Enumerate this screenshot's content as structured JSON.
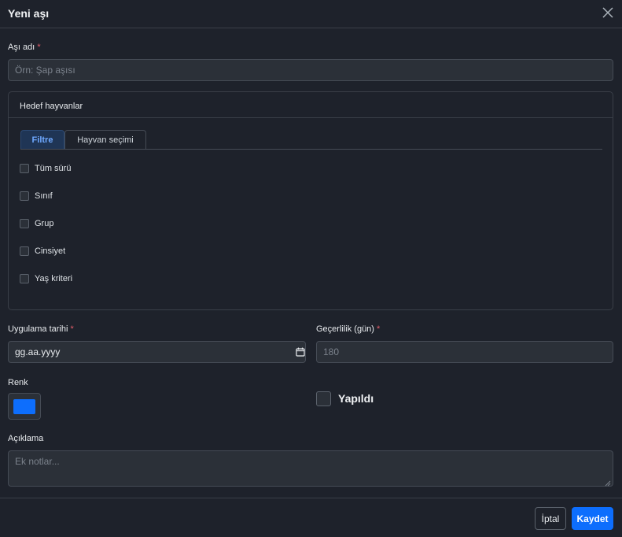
{
  "modal": {
    "title": "Yeni aşı",
    "close_icon": "close-icon"
  },
  "vaccine_name": {
    "label": "Aşı adı",
    "required": "*",
    "value": "",
    "placeholder": "Örn: Şap aşısı"
  },
  "target_animals": {
    "title": "Hedef hayvanlar",
    "tabs": [
      {
        "label": "Filtre",
        "active": true
      },
      {
        "label": "Hayvan seçimi",
        "active": false
      }
    ],
    "filters": [
      {
        "label": "Tüm sürü",
        "checked": false
      },
      {
        "label": "Sınıf",
        "checked": false
      },
      {
        "label": "Grup",
        "checked": false
      },
      {
        "label": "Cinsiyet",
        "checked": false
      },
      {
        "label": "Yaş kriteri",
        "checked": false
      }
    ]
  },
  "application_date": {
    "label": "Uygulama tarihi",
    "required": "*",
    "value": "gg.aa.yyyy",
    "icon": "calendar-icon"
  },
  "validity": {
    "label": "Geçerlilik (gün)",
    "required": "*",
    "value": "",
    "placeholder": "180"
  },
  "color": {
    "label": "Renk",
    "value": "#0d6efd"
  },
  "done": {
    "label": "Yapıldı",
    "checked": false
  },
  "description": {
    "label": "Açıklama",
    "value": "",
    "placeholder": "Ek notlar..."
  },
  "footer": {
    "cancel_label": "İptal",
    "save_label": "Kaydet"
  },
  "colors": {
    "background": "#1e222b",
    "input_bg": "#2b3038",
    "border": "#454b55",
    "accent": "#0d6efd",
    "required": "#e35d6a"
  }
}
